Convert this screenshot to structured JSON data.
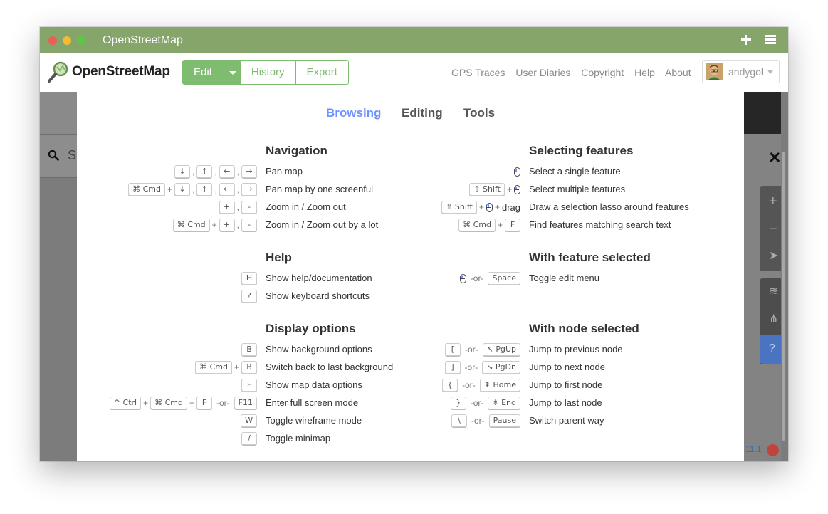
{
  "window": {
    "title": "OpenStreetMap"
  },
  "navbar": {
    "brand": "OpenStreetMap",
    "edit_label": "Edit",
    "history_label": "History",
    "export_label": "Export",
    "links": [
      "GPS Traces",
      "User Diaries",
      "Copyright",
      "Help",
      "About"
    ],
    "user": "andygol"
  },
  "map": {
    "search_placeholder": "S",
    "version": "11.1"
  },
  "modal": {
    "tabs": [
      {
        "label": "Browsing",
        "active": true
      },
      {
        "label": "Editing",
        "active": false
      },
      {
        "label": "Tools",
        "active": false
      }
    ],
    "navigation": {
      "title": "Navigation",
      "rows": [
        {
          "desc": "Pan map"
        },
        {
          "desc": "Pan map by one screenful"
        },
        {
          "desc": "Zoom in / Zoom out"
        },
        {
          "desc": "Zoom in / Zoom out by a lot"
        }
      ]
    },
    "help": {
      "title": "Help",
      "rows": [
        {
          "desc": "Show help/documentation"
        },
        {
          "desc": "Show keyboard shortcuts"
        }
      ]
    },
    "display": {
      "title": "Display options",
      "rows": [
        {
          "desc": "Show background options"
        },
        {
          "desc": "Switch back to last background"
        },
        {
          "desc": "Show map data options"
        },
        {
          "desc": "Enter full screen mode"
        },
        {
          "desc": "Toggle wireframe mode"
        },
        {
          "desc": "Toggle minimap"
        }
      ]
    },
    "selecting": {
      "title": "Selecting features",
      "rows": [
        {
          "desc": "Select a single feature"
        },
        {
          "desc": "Select multiple features"
        },
        {
          "desc": "Draw a selection lasso around features"
        },
        {
          "desc": "Find features matching search text"
        }
      ]
    },
    "feature_selected": {
      "title": "With feature selected",
      "rows": [
        {
          "desc": "Toggle edit menu"
        }
      ]
    },
    "node_selected": {
      "title": "With node selected",
      "rows": [
        {
          "desc": "Jump to previous node"
        },
        {
          "desc": "Jump to next node"
        },
        {
          "desc": "Jump to first node"
        },
        {
          "desc": "Jump to last node"
        },
        {
          "desc": "Switch parent way"
        }
      ]
    },
    "keys": {
      "down": "↓",
      "up": "↑",
      "left": "←",
      "right": "→",
      "cmd": "⌘ Cmd",
      "ctrl": "^ Ctrl",
      "shift": "⇧ Shift",
      "plus": "+",
      "minus": "-",
      "H": "H",
      "question": "?",
      "B": "B",
      "F": "F",
      "F11": "F11",
      "W": "W",
      "slash": "/",
      "space": "Space",
      "lbracket": "[",
      "rbracket": "]",
      "lbrace": "{",
      "rbrace": "}",
      "backslash": "\\",
      "pgup": "↖ PgUp",
      "pgdn": "↘ PgDn",
      "home": "⇞ Home",
      "end": "⇟ End",
      "pause": "Pause",
      "comma": ",",
      "plus_sep": "+",
      "or": "-or-",
      "drag": "drag"
    }
  }
}
